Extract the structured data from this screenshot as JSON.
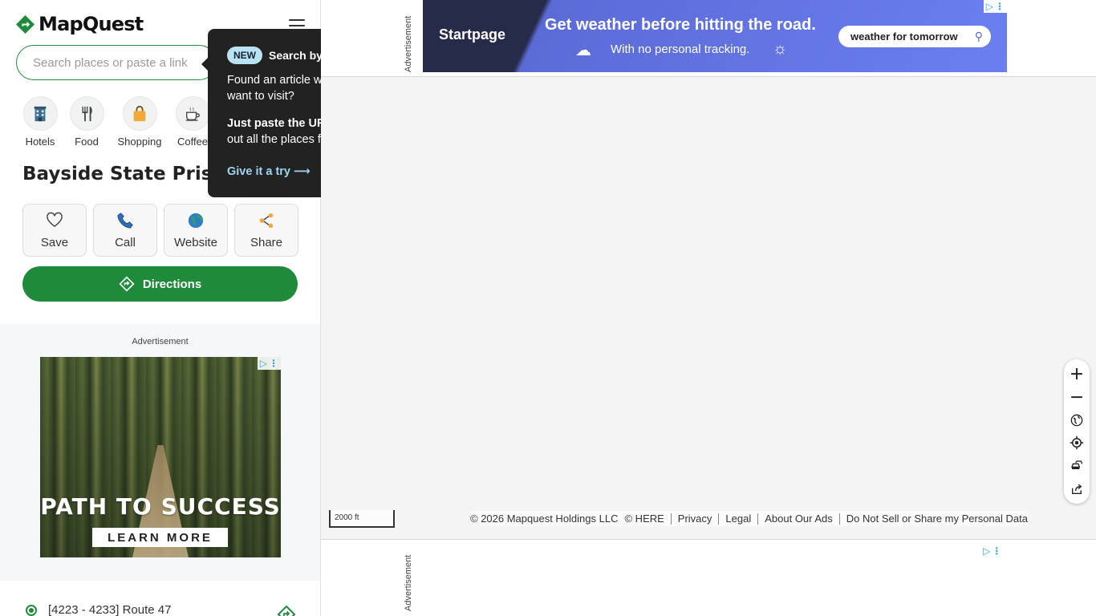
{
  "brand": {
    "name": "MapQuest",
    "accent": "#1f8a3a"
  },
  "search": {
    "placeholder": "Search places or paste a link"
  },
  "categories": [
    {
      "label": "Hotels",
      "icon": "hotel-icon"
    },
    {
      "label": "Food",
      "icon": "fork-knife-icon"
    },
    {
      "label": "Shopping",
      "icon": "shopping-bag-icon"
    },
    {
      "label": "Coffee",
      "icon": "coffee-cup-icon"
    }
  ],
  "place": {
    "title": "Bayside State Prison"
  },
  "actions": [
    {
      "label": "Save",
      "icon": "heart-icon"
    },
    {
      "label": "Call",
      "icon": "phone-icon"
    },
    {
      "label": "Website",
      "icon": "globe-icon"
    },
    {
      "label": "Share",
      "icon": "share-icon"
    }
  ],
  "directions": {
    "label": "Directions"
  },
  "sidebar_ad": {
    "label": "Advertisement",
    "headline": "PATH TO SUCCESS",
    "cta": "LEARN MORE"
  },
  "address": {
    "text": "[4223 - 4233] Route 47"
  },
  "popover": {
    "badge": "NEW",
    "title": "Search by link",
    "p1": "Found an article with places you want to visit?",
    "p2_bold": "Just paste the URL —",
    "p2_rest": " we'll pull out all the places for you.",
    "link": "Give it a try ⟶"
  },
  "top_ad": {
    "side_label": "Advertisement",
    "logo": "Startpage",
    "headline": "Get weather before hitting the road.",
    "sub": "With no personal tracking.",
    "search_value": "weather for tomorrow"
  },
  "map": {
    "scale": "2000 ft",
    "footer": [
      "© 2026 Mapquest Holdings LLC",
      "© HERE",
      "Privacy",
      "Legal",
      "About Our Ads",
      "Do Not Sell or Share my Personal Data"
    ]
  },
  "bottom_ad": {
    "side_label": "Advertisement"
  }
}
